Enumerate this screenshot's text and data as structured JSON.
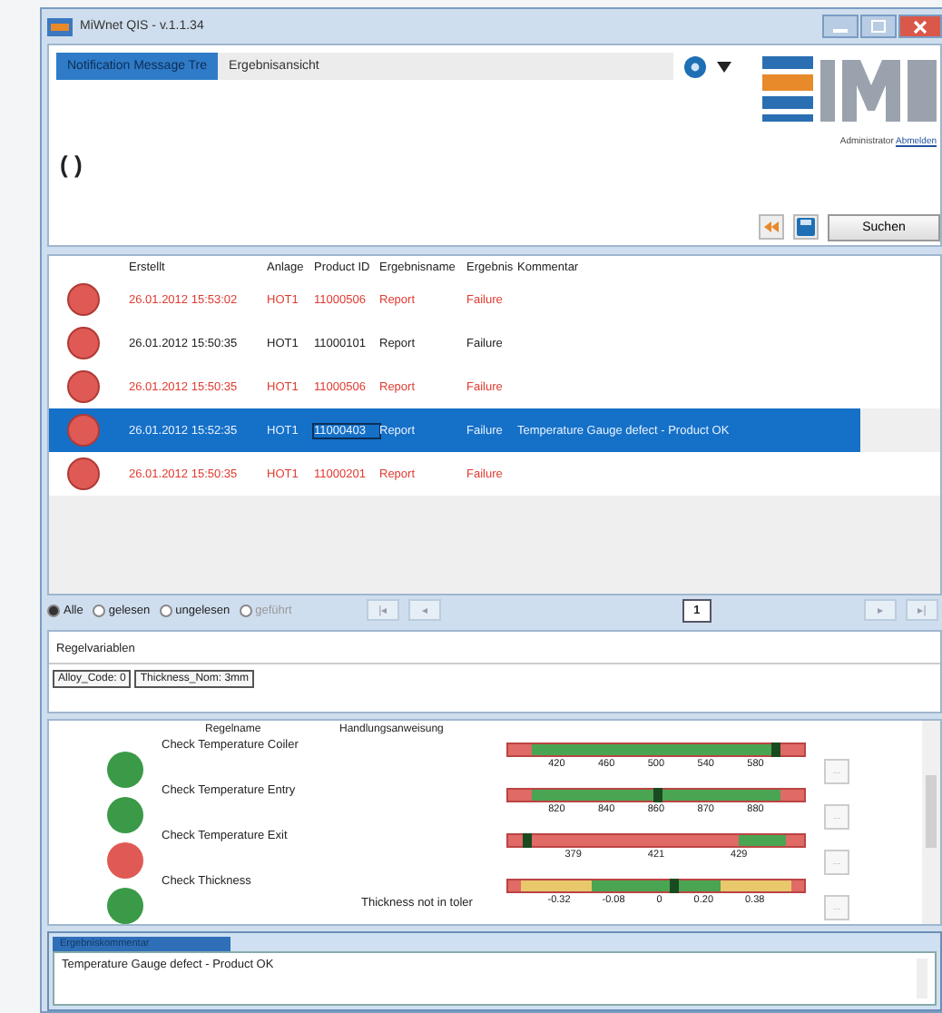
{
  "window": {
    "title": "MiWnet QIS - v.1.1.34"
  },
  "tabs": [
    {
      "label": "Notification Message Tre",
      "selected": true
    },
    {
      "label": "Ergebnisansicht",
      "selected": false
    }
  ],
  "account": {
    "role": "Administrator",
    "link": "Abmelden"
  },
  "filter_text": "(    )",
  "search_button": "Suchen",
  "table": {
    "columns": [
      "Erstellt",
      "Anlage",
      "Product ID",
      "Ergebnisname",
      "Ergebnis",
      "Kommentar"
    ],
    "rows": [
      {
        "color": "#e05a55",
        "unread": true,
        "selected": false,
        "cells": [
          "26.01.2012 15:53:02",
          "HOT1",
          "11000506",
          "Report",
          "Failure",
          ""
        ]
      },
      {
        "color": "#e05a55",
        "unread": false,
        "selected": false,
        "cells": [
          "26.01.2012 15:50:35",
          "HOT1",
          "11000101",
          "Report",
          "Failure",
          ""
        ]
      },
      {
        "color": "#e05a55",
        "unread": true,
        "selected": false,
        "cells": [
          "26.01.2012 15:50:35",
          "HOT1",
          "11000506",
          "Report",
          "Failure",
          ""
        ]
      },
      {
        "color": "#e05a55",
        "unread": false,
        "selected": true,
        "cells": [
          "26.01.2012 15:52:35",
          "HOT1",
          "11000403",
          "Report",
          "Failure",
          "Temperature Gauge defect - Product OK"
        ]
      },
      {
        "color": "#e05a55",
        "unread": true,
        "selected": false,
        "cells": [
          "26.01.2012 15:50:35",
          "HOT1",
          "11000201",
          "Report",
          "Failure",
          ""
        ]
      }
    ]
  },
  "filters": [
    {
      "label": "Alle",
      "selected": true,
      "disabled": false
    },
    {
      "label": "gelesen",
      "selected": false,
      "disabled": false
    },
    {
      "label": "ungelesen",
      "selected": false,
      "disabled": false
    },
    {
      "label": "geführt",
      "selected": false,
      "disabled": true
    }
  ],
  "pager": {
    "first": "|◂",
    "prev": "◂",
    "page": "1",
    "next": "▸",
    "last": "▸|"
  },
  "variables": {
    "title": "Regelvariablen",
    "tags": [
      "Alloy_Code: 0",
      "Thickness_Nom: 3mm"
    ]
  },
  "rules": {
    "columns": [
      "Regelname",
      "Handlungsanweisung"
    ],
    "items": [
      {
        "color": "#3a9a48",
        "name": "Check Temperature Coiler",
        "level": 0.9,
        "kind": "range",
        "ticks": [
          "420",
          "460",
          "500",
          "540",
          "580"
        ],
        "button": "..."
      },
      {
        "color": "#3a9a48",
        "name": "Check Temperature Entry",
        "level": 0.5,
        "kind": "range",
        "ticks": [
          "820",
          "840",
          "860",
          "870",
          "880"
        ],
        "button": "..."
      },
      {
        "color": "#e05a55",
        "name": "Check Temperature Exit",
        "level": 0.06,
        "kind": "upper",
        "ticks": [
          "379",
          "421",
          "429"
        ],
        "button": "..."
      },
      {
        "color": "#3a9a48",
        "name": "Check Thickness",
        "instruction": "Thickness not in toler",
        "level": 0.56,
        "kind": "tolerance",
        "ticks": [
          "-0.32",
          "-0.08",
          "0",
          "0.20",
          "0.38"
        ],
        "button": "..."
      }
    ]
  },
  "comment": {
    "title": "Ergebniskommentar",
    "text": "Temperature Gauge defect - Product OK"
  }
}
